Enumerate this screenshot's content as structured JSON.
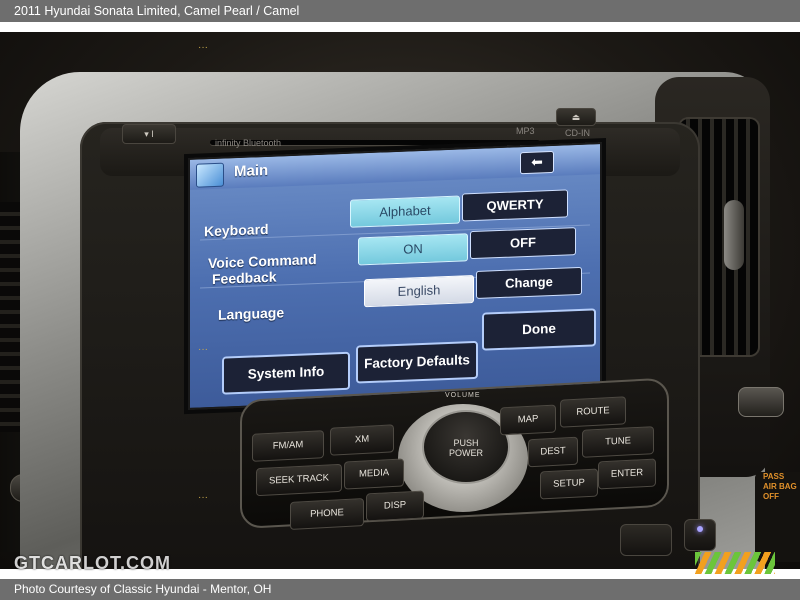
{
  "caption": {
    "title": "2011 Hyundai Sonata Limited,   Camel Pearl / Camel",
    "credit": "Photo Courtesy of Classic Hyundai - Mentor, OH"
  },
  "watermark": "GTCARLOT.COM",
  "head_unit": {
    "brand": "infinity  Bluetooth",
    "media_formats": "MP3",
    "eject_label": "CD-IN"
  },
  "screen": {
    "title": "Main",
    "back_icon": "arrow-left-icon",
    "keyboard": {
      "label": "Keyboard",
      "options": [
        "Alphabet",
        "QWERTY"
      ]
    },
    "voice": {
      "label_line1": "Voice Command",
      "label_line2": "Feedback",
      "options": [
        "ON",
        "OFF"
      ]
    },
    "language": {
      "label": "Language",
      "options": [
        "English",
        "Change"
      ]
    },
    "done_label": "Done",
    "system_info_label": "System Info",
    "factory_defaults_label": "Factory Defaults"
  },
  "controls": {
    "volume_label": "VOLUME",
    "knob_line1": "PUSH",
    "knob_line2": "POWER",
    "fm_am": "FM/AM",
    "xm": "XM",
    "map": "MAP",
    "route": "ROUTE",
    "seek": "SEEK TRACK",
    "media": "MEDIA",
    "dest": "DEST",
    "tune": "TUNE",
    "setup": "SETUP",
    "enter": "ENTER",
    "phone": "PHONE",
    "disp": "DISP"
  },
  "airbag": {
    "line1": "PASS",
    "line2": "AIR BAG",
    "line3": "OFF"
  }
}
